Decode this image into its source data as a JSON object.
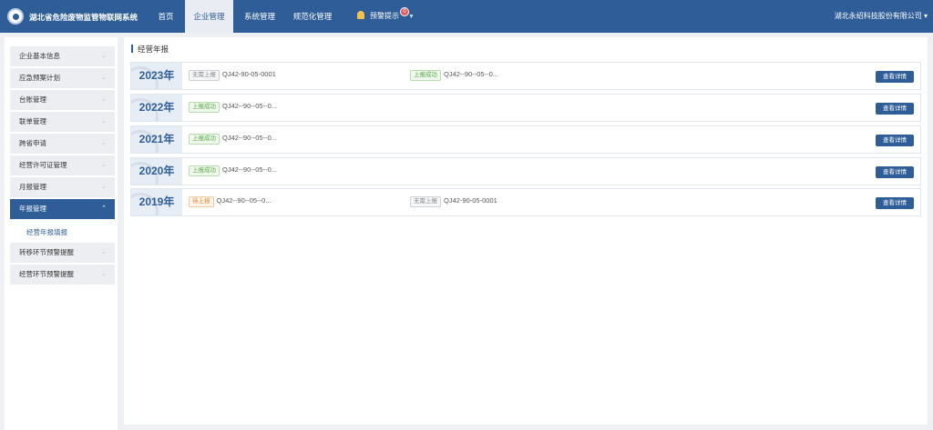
{
  "header": {
    "app_title": "湖北省危险废物监管物联网系统",
    "nav": [
      {
        "label": "首页"
      },
      {
        "label": "企业管理"
      },
      {
        "label": "系统管理"
      },
      {
        "label": "规范化管理"
      }
    ],
    "alert_label": "预警提示",
    "alert_count": "0",
    "company": "湖北永绍科技股份有限公司 ▾"
  },
  "sidebar": {
    "items": [
      {
        "label": "企业基本信息"
      },
      {
        "label": "应急预案计划"
      },
      {
        "label": "台账管理"
      },
      {
        "label": "联单管理"
      },
      {
        "label": "跨省申请"
      },
      {
        "label": "经营许可证管理"
      },
      {
        "label": "月报管理"
      },
      {
        "label": "年报管理"
      },
      {
        "label": "转移环节预警提醒"
      },
      {
        "label": "经营环节预警提醒"
      }
    ],
    "active_sub": "经营年报填报"
  },
  "main": {
    "title": "经营年报",
    "detail_label": "查看详情",
    "reports": [
      {
        "year": "2023年",
        "entries": [
          {
            "tag": "无需上报",
            "tag_style": "gray",
            "code": "QJ42-90-05-0001"
          },
          {
            "tag": "上报成功",
            "tag_style": "green",
            "code": "QJ42--90--05--0..."
          }
        ]
      },
      {
        "year": "2022年",
        "entries": [
          {
            "tag": "上报成功",
            "tag_style": "green",
            "code": "QJ42--90--05--0..."
          }
        ]
      },
      {
        "year": "2021年",
        "entries": [
          {
            "tag": "上报成功",
            "tag_style": "green",
            "code": "QJ42--90--05--0..."
          }
        ]
      },
      {
        "year": "2020年",
        "entries": [
          {
            "tag": "上报成功",
            "tag_style": "green",
            "code": "QJ42--90--05--0..."
          }
        ]
      },
      {
        "year": "2019年",
        "entries": [
          {
            "tag": "待上报",
            "tag_style": "orange",
            "code": "QJ42--90--05--0..."
          },
          {
            "tag": "无需上报",
            "tag_style": "gray",
            "code": "QJ42-90-05-0001"
          }
        ]
      }
    ]
  },
  "colors": {
    "brand": "#2e5d98",
    "success": "#5aa84a",
    "pending": "#e7893a",
    "neutral": "#888888"
  }
}
